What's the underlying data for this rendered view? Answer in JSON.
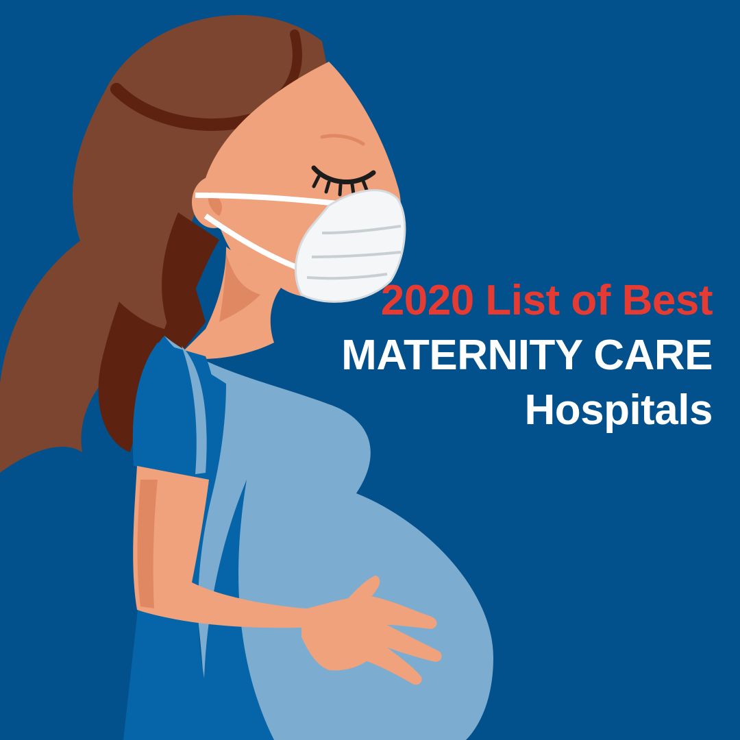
{
  "headline": {
    "line_1": "2020 List of Best",
    "line_2": "MATERNITY CARE",
    "line_3": "Hospitals"
  },
  "illustration": {
    "subject": "pregnant-woman-wearing-face-mask-illustration"
  },
  "colors": {
    "background": "#02508c",
    "accent_red": "#e63b32",
    "text_white": "#ffffff",
    "hair": "#7c4530",
    "hair_dark": "#5e2210",
    "skin": "#f0a27d",
    "skin_shade": "#e08862",
    "dress_dark": "#0665a9",
    "dress_light": "#7cadd0",
    "mask": "#f4f6f7"
  }
}
